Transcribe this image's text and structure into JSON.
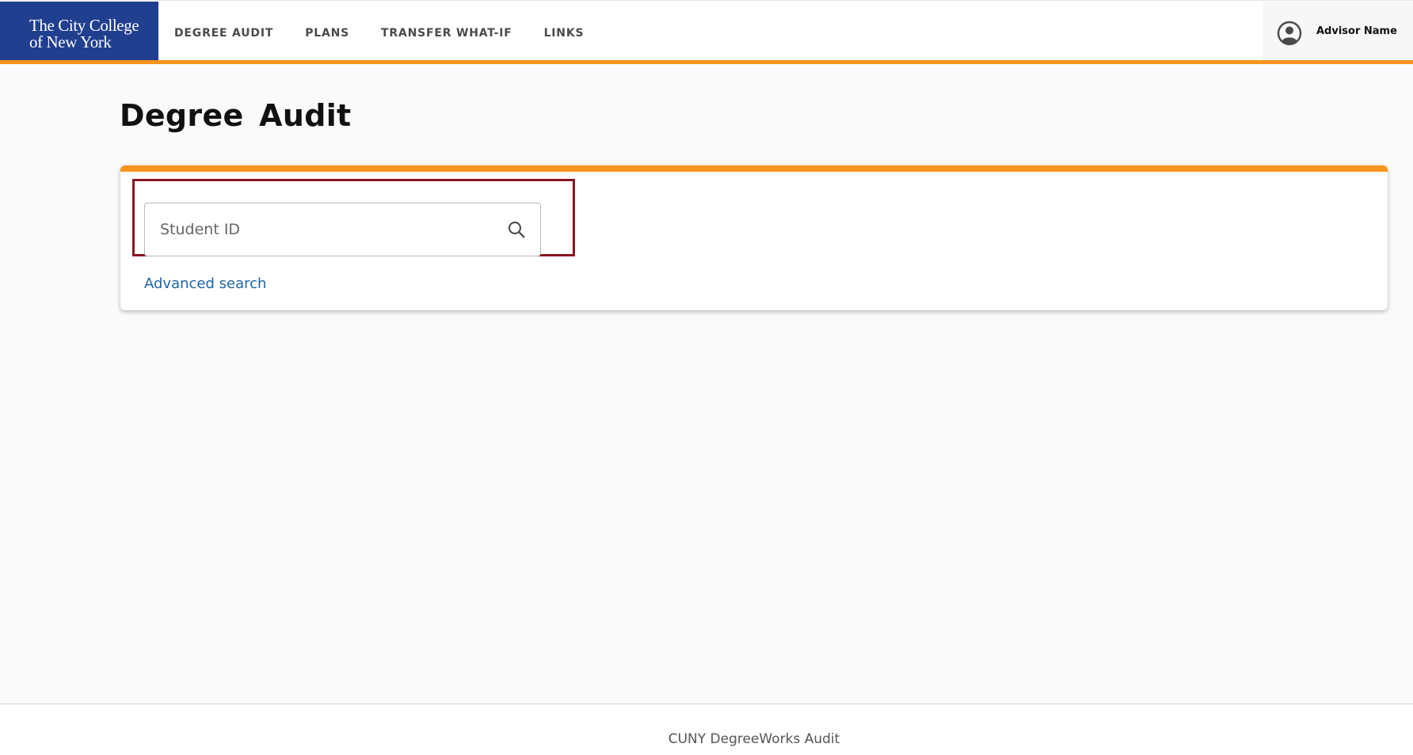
{
  "header": {
    "logo": {
      "line1": "The City College",
      "line2": "of New York"
    },
    "nav": [
      {
        "label": "DEGREE AUDIT"
      },
      {
        "label": "PLANS"
      },
      {
        "label": "TRANSFER WHAT-IF"
      },
      {
        "label": "LINKS"
      }
    ],
    "user": {
      "icon": "user-circle-icon",
      "name": "Advisor Name"
    }
  },
  "main": {
    "title": "Degree Audit",
    "search": {
      "placeholder": "Student ID",
      "value": "",
      "icon": "search-icon",
      "advanced_link": "Advanced search"
    }
  },
  "footer": {
    "text": "CUNY DegreeWorks Audit"
  },
  "colors": {
    "brand_blue": "#213f8f",
    "accent_orange": "#f7941d",
    "highlight_red": "#8a1524",
    "link_blue": "#1f64a8"
  }
}
